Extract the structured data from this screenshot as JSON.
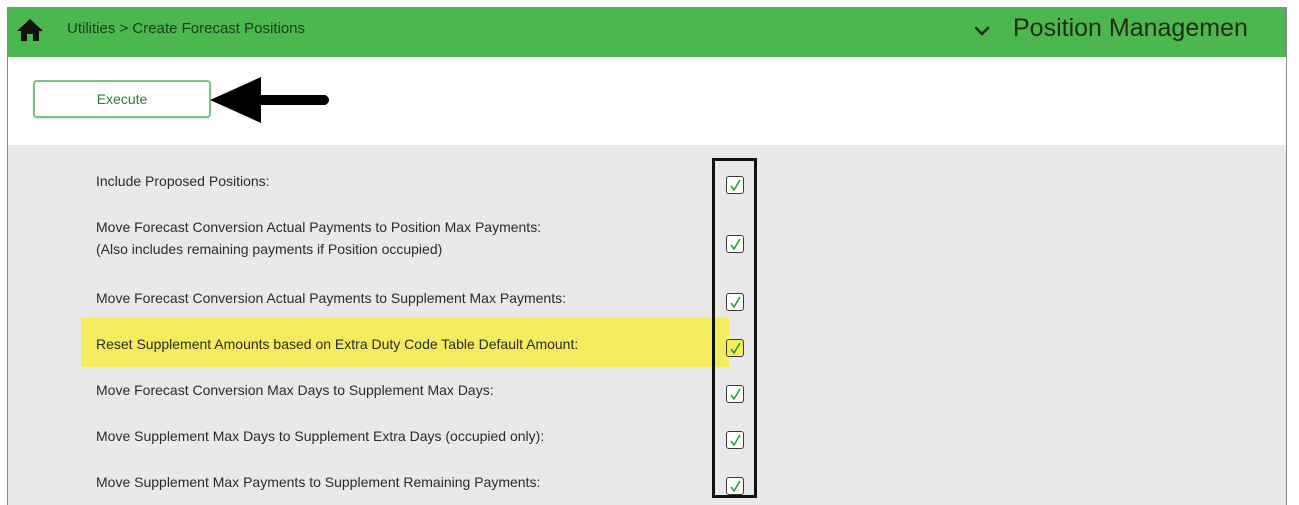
{
  "header": {
    "breadcrumb": "Utilities > Create Forecast Positions",
    "app_title": "Position Managemen",
    "bar_color": "#4cb74f"
  },
  "toolbar": {
    "execute_label": "Execute"
  },
  "options": [
    {
      "label": "Include Proposed Positions:",
      "checked": true
    },
    {
      "label": "Move Forecast Conversion Actual Payments to Position Max Payments:",
      "label2": "(Also includes remaining payments if Position occupied)",
      "checked": true
    },
    {
      "label": "Move Forecast Conversion Actual Payments to Supplement Max Payments:",
      "checked": true
    },
    {
      "label": "Reset Supplement Amounts based on Extra Duty Code Table Default Amount:",
      "checked": true,
      "highlighted": true
    },
    {
      "label": "Move Forecast Conversion Max Days to Supplement Max Days:",
      "checked": true
    },
    {
      "label": "Move Supplement Max Days to Supplement Extra Days (occupied only):",
      "checked": true
    },
    {
      "label": "Move Supplement Max Payments to Supplement Remaining Payments:",
      "checked": true
    }
  ],
  "annotation_colors": {
    "highlight": "#f3ec5e",
    "arrow": "#000000"
  }
}
